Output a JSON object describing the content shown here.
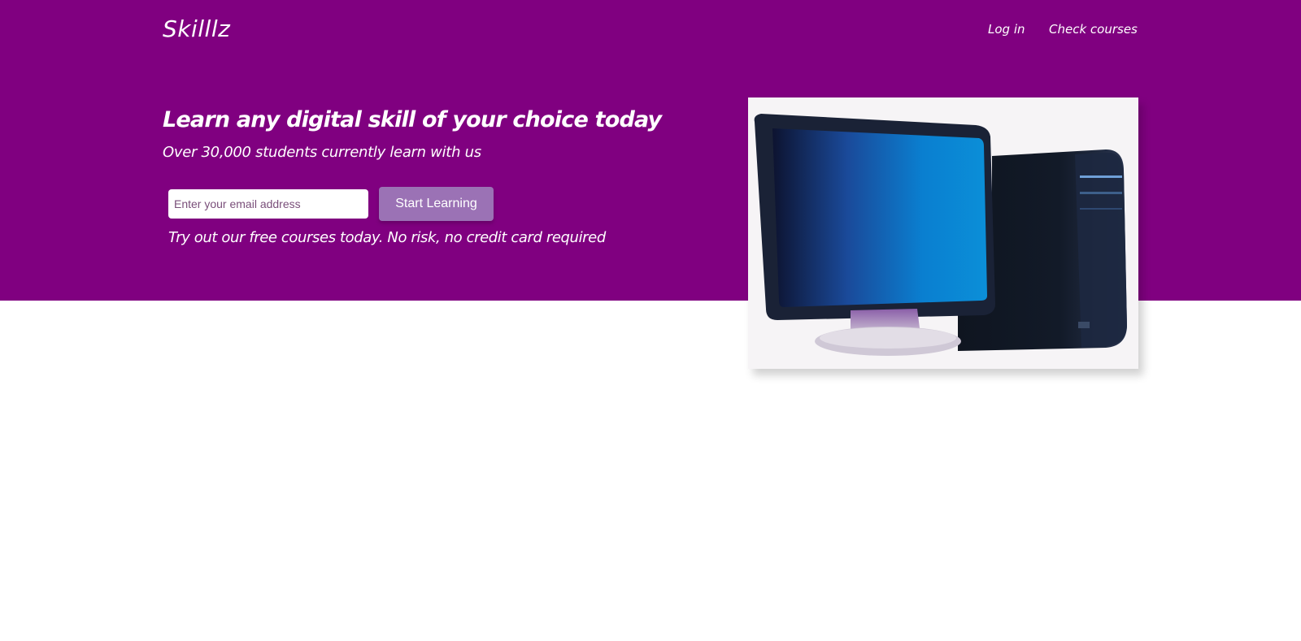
{
  "header": {
    "logo": "Skilllz",
    "nav": {
      "login": "Log in",
      "courses": "Check courses"
    }
  },
  "hero": {
    "headline": "Learn any digital skill of your choice today",
    "subheadline": "Over 30,000 students currently learn with us",
    "email_placeholder": "Enter your email address",
    "email_value": "",
    "cta_label": "Start Learning",
    "note": "Try out our free courses today. No risk, no credit card required",
    "image_icon": "desktop-computer-icon"
  },
  "colors": {
    "brand": "#800080",
    "button": "#9b72b5",
    "background": "#ffffff"
  }
}
